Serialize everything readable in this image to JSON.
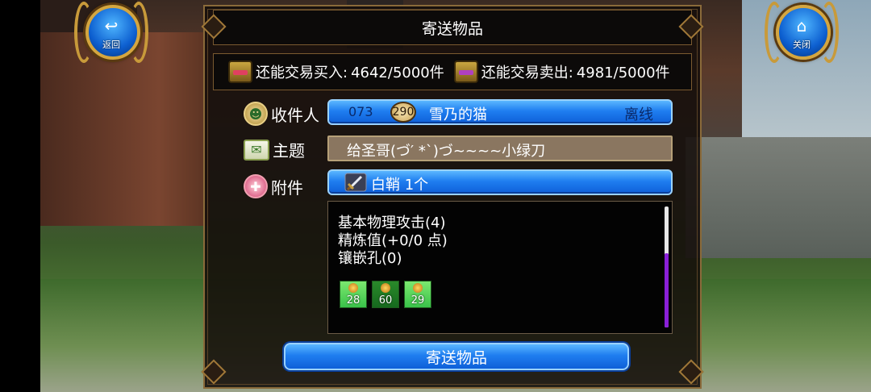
{
  "top_buttons": {
    "back": {
      "glyph": "↩",
      "label": "返回"
    },
    "close": {
      "glyph": "⌂",
      "label": "关闭"
    }
  },
  "dialog": {
    "title": "寄送物品",
    "trade_limits": {
      "buy_label": "还能交易买入:",
      "buy_value": "4642/5000件",
      "sell_label": "还能交易卖出:",
      "sell_value": "4981/5000件"
    },
    "recipient": {
      "label": "收件人",
      "id": "073",
      "level": "290",
      "name": "雪乃的猫",
      "status": "离线"
    },
    "subject": {
      "label": "主题",
      "value": "给圣哥(づ′ *`)づ~~~~小绿刀"
    },
    "attachment": {
      "label": "附件",
      "item": "白鞘 1个",
      "details": [
        "基本物理攻击(4)",
        "精炼值(+0/0 点)",
        "镶嵌孔(0)"
      ],
      "gems": [
        "28",
        "60",
        "29"
      ]
    },
    "send_button": "寄送物品"
  },
  "colors": {
    "button_blue": "#1f7ef0",
    "panel_border": "#8a6a3a",
    "scroll_thumb": "#8a1fd8"
  },
  "icons": {
    "recipient": "person-icon",
    "subject": "mail-icon",
    "attachment": "gift-icon",
    "item": "sword-icon"
  }
}
